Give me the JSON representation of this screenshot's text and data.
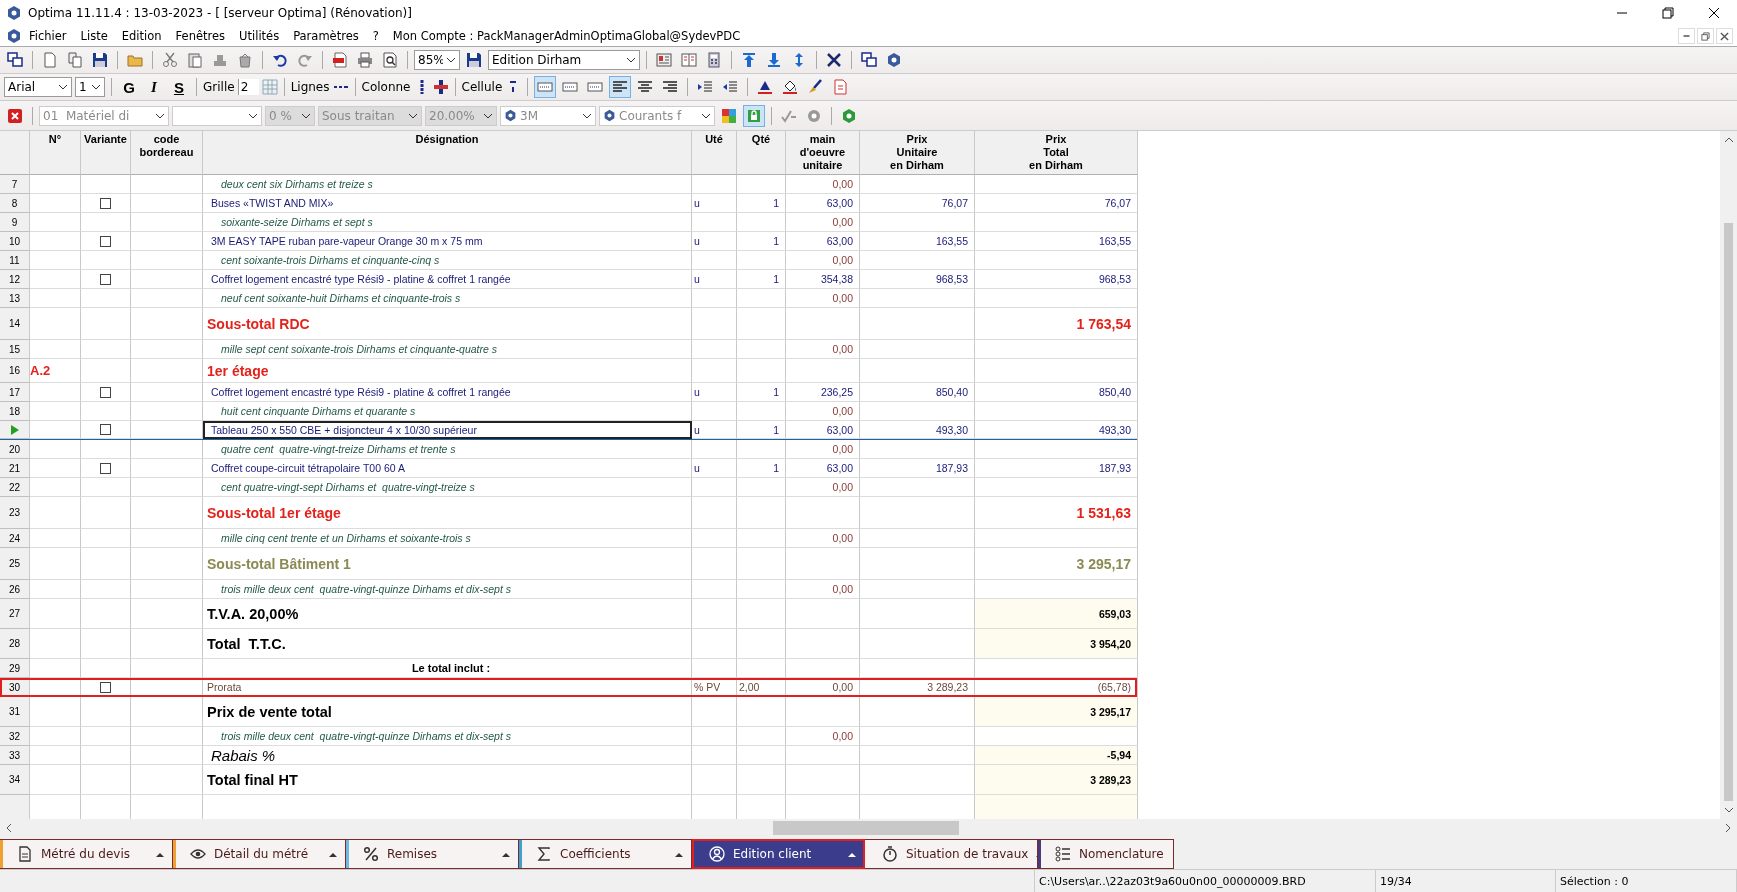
{
  "window": {
    "title": "Optima 11.11.4 : 13-03-2023 - [ [serveur Optima] (Rénovation)]"
  },
  "menu": {
    "items": [
      "Fichier",
      "Liste",
      "Edition",
      "Fenêtres",
      "Utilités",
      "Paramètres",
      "?"
    ],
    "account": "Mon Compte : PackManagerAdminOptimaGlobal@SydevPDC"
  },
  "toolbar": {
    "zoom": "85%",
    "view": "Edition Dirham"
  },
  "format_bar": {
    "font": "Arial",
    "size": "1",
    "bold": "G",
    "italic": "I",
    "strike": "S",
    "grid_label": "Grille",
    "grid_value": "2",
    "lines_label": "Lignes",
    "columns_label": "Colonne",
    "cell_label": "Cellule"
  },
  "filter_bar": {
    "combos": [
      {
        "value": "01  Matériel di",
        "kind": "plain"
      },
      {
        "kind": "plain"
      },
      {
        "value": "0 %",
        "kind": "shaded"
      },
      {
        "value": "Sous traitan",
        "kind": "shaded"
      },
      {
        "value": "20.00%",
        "kind": "shaded"
      },
      {
        "value": "3M",
        "kind": "logo"
      },
      {
        "value": "Courants f",
        "kind": "logo"
      }
    ]
  },
  "table": {
    "columns": [
      "",
      "N°",
      "Variante",
      "code\nbordereau",
      "Désignation",
      "Uté",
      "Qté",
      "main\nd'oeuvre\nunitaire",
      "Prix\nUnitaire\nen Dirham",
      "Prix\nTotal\nen Dirham"
    ],
    "rows": [
      {
        "num": "7",
        "kind": "words",
        "designation": "deux cent six Dirhams et treize s",
        "mo": "0,00",
        "selected": false,
        "current": false
      },
      {
        "num": "8",
        "kind": "item",
        "variante": {
          "checked": false
        },
        "designation": "Buses «TWIST AND MIX»",
        "unit": "u",
        "qty": "1",
        "mo": "63,00",
        "pu": "76,07",
        "pt": "76,07",
        "selected": false,
        "current": false
      },
      {
        "num": "9",
        "kind": "words",
        "designation": "soixante-seize Dirhams et sept s",
        "mo": "0,00",
        "selected": false,
        "current": false
      },
      {
        "num": "10",
        "kind": "item",
        "variante": {
          "checked": false
        },
        "designation": "3M EASY TAPE ruban pare-vapeur Orange 30 m x 75 mm",
        "unit": "u",
        "qty": "1",
        "mo": "63,00",
        "pu": "163,55",
        "pt": "163,55",
        "selected": false,
        "current": false
      },
      {
        "num": "11",
        "kind": "words",
        "designation": "cent soixante-trois Dirhams et cinquante-cinq s",
        "mo": "0,00",
        "selected": false,
        "current": false
      },
      {
        "num": "12",
        "kind": "item",
        "variante": {
          "checked": false
        },
        "designation": "Coffret logement encastré type Rési9 - platine & coffret 1 rangée",
        "unit": "u",
        "qty": "1",
        "mo": "354,38",
        "pu": "968,53",
        "pt": "968,53",
        "selected": false,
        "current": false
      },
      {
        "num": "13",
        "kind": "words",
        "designation": "neuf cent soixante-huit Dirhams et cinquante-trois s",
        "mo": "0,00",
        "selected": false,
        "current": false
      },
      {
        "num": "14",
        "kind": "subtotal",
        "color": "#e3231b",
        "designation": "Sous-total RDC",
        "pt": "1 763,54",
        "selected": false,
        "current": false
      },
      {
        "num": "15",
        "kind": "words",
        "designation": "mille sept cent soixante-trois Dirhams et cinquante-quatre s",
        "mo": "0,00",
        "selected": false,
        "current": false
      },
      {
        "num": "16",
        "kind": "section",
        "n": "A.2",
        "designation": "1er étage",
        "selected": false,
        "current": false
      },
      {
        "num": "17",
        "kind": "item",
        "variante": {
          "checked": false
        },
        "designation": "Coffret logement encastré type Rési9 - platine & coffret 1 rangée",
        "unit": "u",
        "qty": "1",
        "mo": "236,25",
        "pu": "850,40",
        "pt": "850,40",
        "selected": false,
        "current": false
      },
      {
        "num": "18",
        "kind": "words",
        "designation": "huit cent cinquante Dirhams et quarante s",
        "mo": "0,00",
        "selected": false,
        "current": false
      },
      {
        "kind": "item",
        "variante": {
          "checked": false
        },
        "designation": "Tableau 250 x 550 CBE + disjoncteur 4 x 10/30 supérieur",
        "unit": "u",
        "qty": "1",
        "mo": "63,00",
        "pu": "493,30",
        "pt": "493,30",
        "selected": false,
        "current": true
      },
      {
        "num": "20",
        "kind": "words",
        "designation": "quatre cent  quatre-vingt-treize Dirhams et trente s",
        "mo": "0,00",
        "selected": false,
        "current": false
      },
      {
        "num": "21",
        "kind": "item",
        "variante": {
          "checked": false
        },
        "designation": "Coffret coupe-circuit tétrapolaire T00 60 A",
        "unit": "u",
        "qty": "1",
        "mo": "63,00",
        "pu": "187,93",
        "pt": "187,93",
        "selected": false,
        "current": false
      },
      {
        "num": "22",
        "kind": "words",
        "designation": "cent quatre-vingt-sept Dirhams et  quatre-vingt-treize s",
        "mo": "0,00",
        "selected": false,
        "current": false
      },
      {
        "num": "23",
        "kind": "subtotal",
        "color": "#e3231b",
        "designation": "Sous-total 1er étage",
        "pt": "1 531,63",
        "selected": false,
        "current": false
      },
      {
        "num": "24",
        "kind": "words",
        "designation": "mille cinq cent trente et un Dirhams et soixante-trois s",
        "mo": "0,00",
        "selected": false,
        "current": false
      },
      {
        "num": "25",
        "kind": "subtotal",
        "color": "#8a8a52",
        "designation": "Sous-total Bâtiment 1",
        "pt": "3 295,17",
        "selected": false,
        "current": false
      },
      {
        "num": "26",
        "kind": "words",
        "designation": "trois mille deux cent  quatre-vingt-quinze Dirhams et dix-sept s",
        "mo": "0,00",
        "selected": false,
        "current": false
      },
      {
        "num": "27",
        "kind": "total",
        "designation": "T.V.A. 20,00%",
        "pt": "659,03",
        "selected": false,
        "current": false
      },
      {
        "num": "28",
        "kind": "total",
        "designation": "Total  T.T.C.",
        "pt": "3 954,20",
        "selected": false,
        "current": false
      },
      {
        "num": "29",
        "kind": "note",
        "designation": "Le total inclut :",
        "selected": false,
        "current": false
      },
      {
        "num": "30",
        "kind": "prorata",
        "variante": {
          "checked": false
        },
        "designation": "Prorata",
        "unit": "% PV",
        "qty": "2,00",
        "mo": "0,00",
        "pu": "3 289,23",
        "pt": "(65,78)",
        "selected": true,
        "current": false
      },
      {
        "num": "31",
        "kind": "total",
        "designation": "Prix de vente total",
        "pt": "3 295,17",
        "selected": false,
        "current": false
      },
      {
        "num": "32",
        "kind": "words",
        "designation": "trois mille deux cent  quatre-vingt-quinze Dirhams et dix-sept s",
        "mo": "0,00",
        "selected": false,
        "current": false
      },
      {
        "num": "33",
        "kind": "rabais",
        "designation": "Rabais %",
        "pt": "-5,94",
        "selected": false,
        "current": false
      },
      {
        "num": "34",
        "kind": "total",
        "designation": "Total final HT",
        "pt": "3 289,23",
        "selected": false,
        "current": false
      }
    ]
  },
  "tabs": [
    {
      "label": "Métré du devis",
      "kind": "document",
      "color": "#f0a030",
      "has_menu": true,
      "selected": false
    },
    {
      "label": "Détail du métré",
      "kind": "eye",
      "color": "#f0a030",
      "has_menu": true,
      "selected": false
    },
    {
      "label": "Remises",
      "kind": "percent",
      "color": "#70b8e0",
      "has_menu": true,
      "selected": false
    },
    {
      "label": "Coefficients",
      "kind": "sigma",
      "color": "#40a0d0",
      "has_menu": true,
      "selected": false
    },
    {
      "label": "Edition client",
      "kind": "user",
      "has_menu": true,
      "selected": true
    },
    {
      "label": "Situation de travaux",
      "kind": "clock",
      "has_menu": true,
      "selected": false
    },
    {
      "label": "Nomenclature",
      "kind": "list",
      "color": "#4a3c7c",
      "has_menu": false,
      "selected": false
    }
  ],
  "status_bar": {
    "path": "C:\\Users\\ar..\\22az03t9a60u0n00_00000009.BRD",
    "position": "19/34",
    "selection": "Sélection : 0"
  }
}
